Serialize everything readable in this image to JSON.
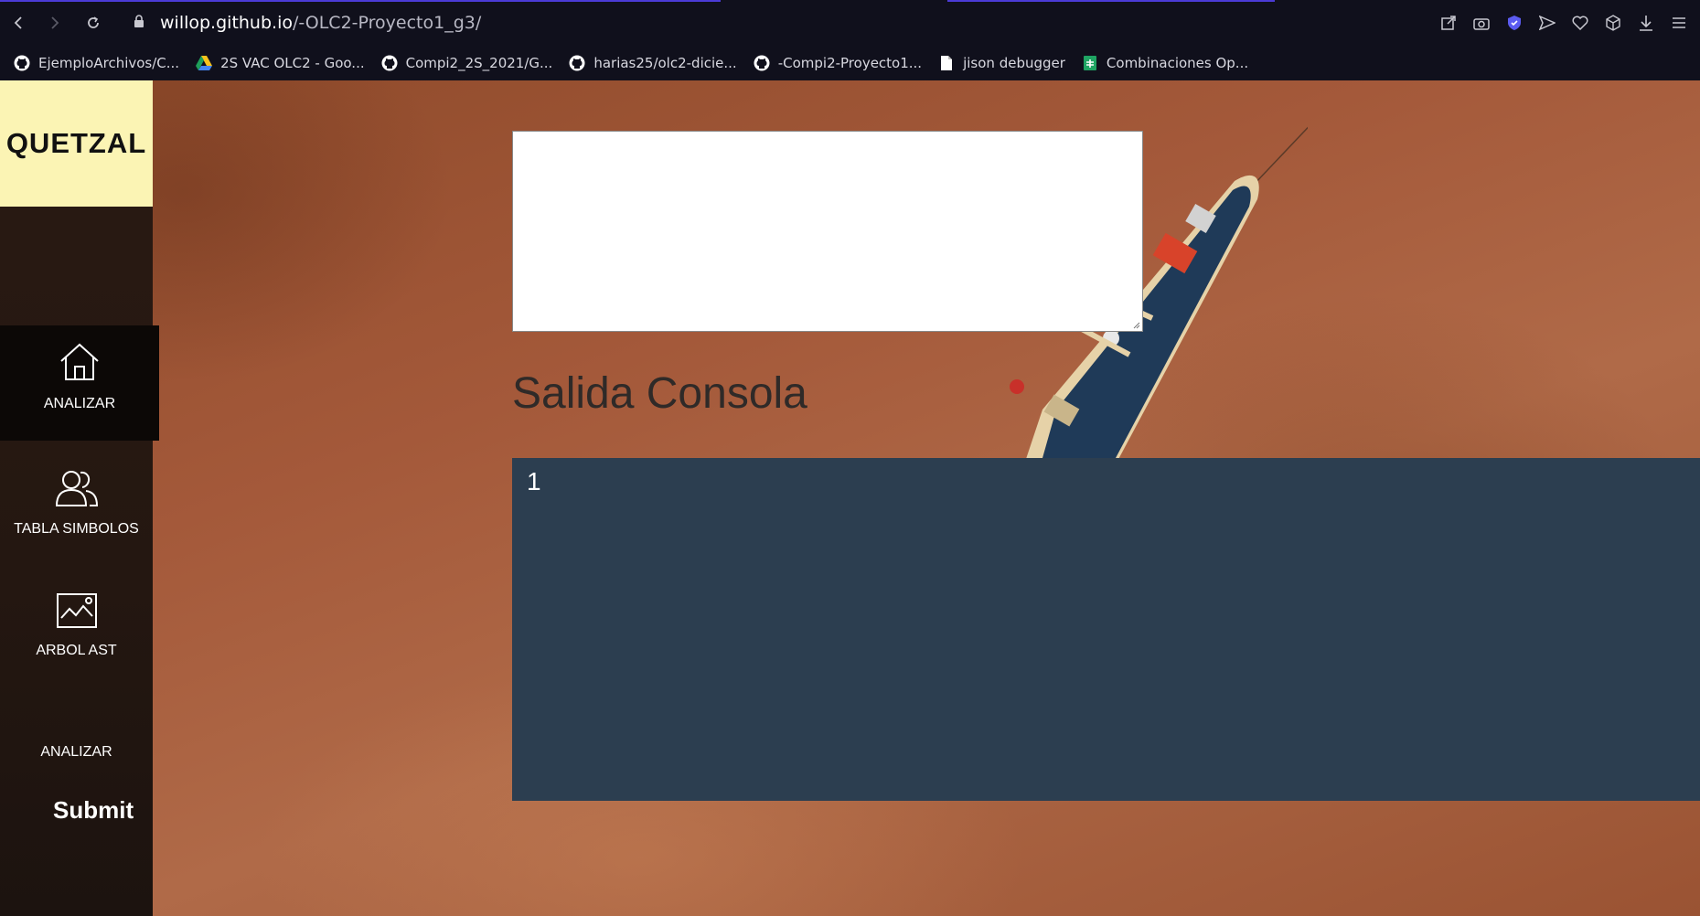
{
  "browser": {
    "url_host": "willop.github.io",
    "url_path": "/-OLC2-Proyecto1_g3/",
    "bookmarks": [
      {
        "label": "EjemploArchivos/C...",
        "icon": "github-icon"
      },
      {
        "label": "2S VAC OLC2 - Goo...",
        "icon": "google-drive-icon"
      },
      {
        "label": "Compi2_2S_2021/G...",
        "icon": "github-icon"
      },
      {
        "label": "harias25/olc2-dicie...",
        "icon": "github-icon"
      },
      {
        "label": "-Compi2-Proyecto1...",
        "icon": "github-icon"
      },
      {
        "label": "jison debugger",
        "icon": "document-icon"
      },
      {
        "label": "Combinaciones Op...",
        "icon": "google-sheets-icon"
      }
    ]
  },
  "sidebar": {
    "brand": "QUETZAL",
    "items": [
      {
        "label": "ANALIZAR",
        "icon": "home-icon",
        "active": true
      },
      {
        "label": "TABLA SIMBOLOS",
        "icon": "users-icon",
        "active": false
      },
      {
        "label": "ARBOL AST",
        "icon": "image-icon",
        "active": false
      },
      {
        "label": "ANALIZAR",
        "icon": "",
        "active": false
      }
    ],
    "submit_label": "Submit"
  },
  "main": {
    "editor_value": "",
    "console_title": "Salida Consola",
    "console_lines": [
      "1"
    ]
  },
  "colors": {
    "brand_bg": "#fbf4b4",
    "console_bg": "#2c3e50",
    "active_item_bg": "#0c0806"
  }
}
